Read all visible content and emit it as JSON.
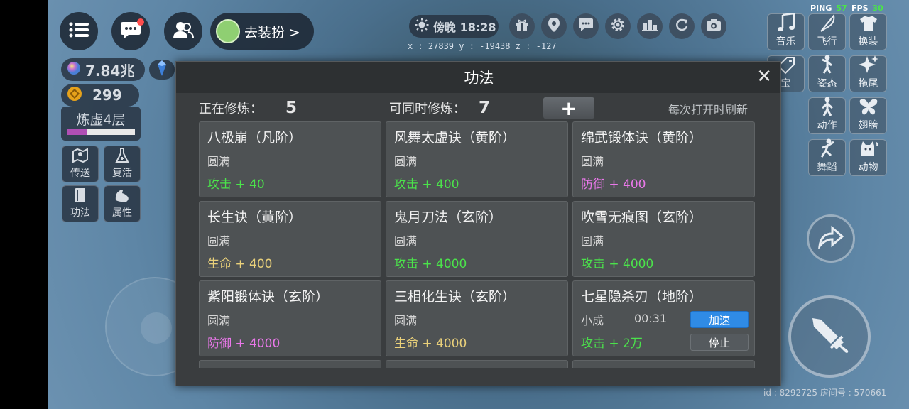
{
  "hud": {
    "dress_label": "去装扮 >",
    "time": "傍晚 18:28",
    "coords": "x : 27839    y : -19438    z : -127",
    "ping_label": "PING",
    "ping_value": "57",
    "fps_label": "FPS",
    "fps_value": "30",
    "currency_1": "7.84兆",
    "currency_2": "299",
    "realm": "炼虚4层",
    "realm_progress": 0.3,
    "id_line": "id : 8292725  房间号 : 570661"
  },
  "left_tiles": [
    "传送",
    "复活",
    "功法",
    "属性"
  ],
  "right_tiles": [
    "音乐",
    "飞行",
    "换装",
    "宝",
    "姿态",
    "拖尾",
    "动作",
    "翅膀",
    "舞蹈",
    "动物"
  ],
  "panel": {
    "title": "功法",
    "close": "✕",
    "training_label": "正在修炼：",
    "training_count": "5",
    "max_label": "可同时修炼：",
    "max_count": "7",
    "plus": "+",
    "refresh_note": "每次打开时刷新",
    "cards": [
      {
        "name": "八极崩（凡阶）",
        "level": "圆满",
        "effect": "攻击 + 40"
      },
      {
        "name": "风舞太虚诀（黄阶）",
        "level": "圆满",
        "effect": "攻击 + 400"
      },
      {
        "name": "绵武锻体诀（黄阶）",
        "level": "圆满",
        "effect": "防御 + 400"
      },
      {
        "name": "长生诀（黄阶）",
        "level": "圆满",
        "effect": "生命 + 400"
      },
      {
        "name": "鬼月刀法（玄阶）",
        "level": "圆满",
        "effect": "攻击 + 4000"
      },
      {
        "name": "吹雪无痕图（玄阶）",
        "level": "圆满",
        "effect": "攻击 + 4000"
      },
      {
        "name": "紫阳锻体诀（玄阶）",
        "level": "圆满",
        "effect": "防御 + 4000"
      },
      {
        "name": "三相化生诀（玄阶）",
        "level": "圆满",
        "effect": "生命 + 4000"
      },
      {
        "name": "七星隐杀刃（地阶）",
        "level": "小成",
        "effect": "攻击 + 2万",
        "timer": "00:31",
        "speed_btn": "加速",
        "stop_btn": "停止"
      }
    ]
  },
  "colors": {
    "attack": "#4be34b",
    "defense": "#e978e9",
    "health": "#e9d07a",
    "speed_button": "#2f8be6",
    "panel_bg": "#3a3d3f"
  },
  "icons": [
    "menu-icon",
    "chat-icon",
    "friends-icon",
    "sun-icon",
    "gift-icon",
    "location-icon",
    "message-icon",
    "settings-icon",
    "ranking-icon",
    "refresh-icon",
    "camera-icon",
    "sword-icon",
    "jump-icon"
  ]
}
